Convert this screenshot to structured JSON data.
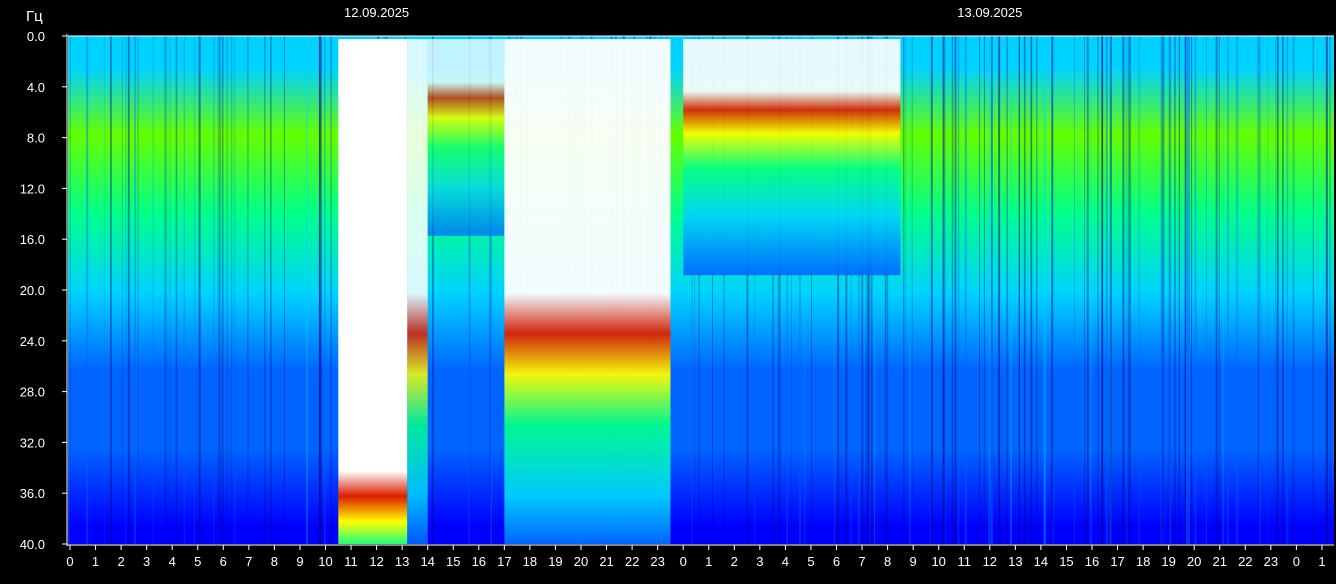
{
  "chart_data": {
    "type": "heatmap",
    "title": "",
    "ylabel": "Гц",
    "xlabel": "",
    "date_labels": [
      {
        "text": "12.09.2025",
        "at_hour": 12
      },
      {
        "text": "13.09.2025",
        "at_hour": 36
      }
    ],
    "y_ticks": [
      "0.0",
      "4.0",
      "8.0",
      "12.0",
      "16.0",
      "20.0",
      "24.0",
      "28.0",
      "32.0",
      "36.0",
      "40.0"
    ],
    "ylim": [
      0,
      40
    ],
    "x_ticks": [
      "0",
      "1",
      "2",
      "3",
      "4",
      "5",
      "6",
      "7",
      "8",
      "9",
      "10",
      "11",
      "12",
      "13",
      "14",
      "15",
      "16",
      "17",
      "18",
      "19",
      "20",
      "21",
      "22",
      "23",
      "0",
      "1",
      "2",
      "3",
      "4",
      "5",
      "6",
      "7",
      "8",
      "9",
      "10",
      "11",
      "12",
      "13",
      "14",
      "15",
      "16",
      "17",
      "18",
      "19",
      "20",
      "21",
      "22",
      "23",
      "0",
      "1"
    ],
    "xlim_hours": [
      0,
      49.5
    ],
    "color_scale": [
      "#00006e",
      "#0000ff",
      "#0064ff",
      "#00d2ff",
      "#00ff8c",
      "#64ff00",
      "#ffff00",
      "#ff8c00",
      "#dc1e00",
      "#ffffff"
    ],
    "background_max_frequency_profile": [
      {
        "freq": 0,
        "level": 0.35
      },
      {
        "freq": 2.5,
        "level": 0.42
      },
      {
        "freq": 7.8,
        "level": 0.58
      },
      {
        "freq": 14.1,
        "level": 0.48
      },
      {
        "freq": 20.3,
        "level": 0.4
      },
      {
        "freq": 26.4,
        "level": 0.3
      },
      {
        "freq": 32.5,
        "level": 0.22
      },
      {
        "freq": 38.6,
        "level": 0.18
      }
    ],
    "bursts": [
      {
        "start_hour": 10.5,
        "end_hour": 13.2,
        "saturated_to_freq": 40,
        "intensity": 1.0
      },
      {
        "start_hour": 13.2,
        "end_hour": 14.0,
        "saturated_to_freq": 28,
        "intensity": 0.85
      },
      {
        "start_hour": 14.0,
        "end_hour": 17.0,
        "saturated_to_freq": 10,
        "intensity": 0.75
      },
      {
        "start_hour": 17.0,
        "end_hour": 23.5,
        "saturated_to_freq": 26,
        "intensity": 0.95
      },
      {
        "start_hour": 24.0,
        "end_hour": 32.5,
        "saturated_to_freq": 12,
        "intensity": 0.9
      }
    ]
  }
}
